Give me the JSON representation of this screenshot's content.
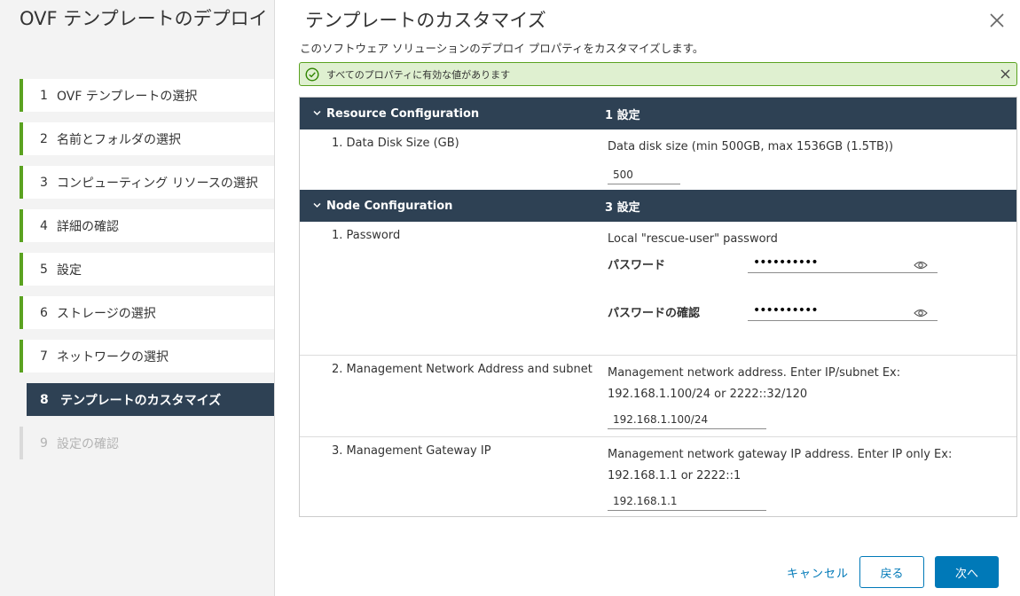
{
  "wizard": {
    "title": "OVF テンプレートのデプロイ",
    "steps": [
      {
        "num": "1",
        "label": "OVF テンプレートの選択"
      },
      {
        "num": "2",
        "label": "名前とフォルダの選択"
      },
      {
        "num": "3",
        "label": "コンピューティング リソースの選択"
      },
      {
        "num": "4",
        "label": "詳細の確認"
      },
      {
        "num": "5",
        "label": "設定"
      },
      {
        "num": "6",
        "label": "ストレージの選択"
      },
      {
        "num": "7",
        "label": "ネットワークの選択"
      },
      {
        "num": "8",
        "label": "テンプレートのカスタマイズ"
      },
      {
        "num": "9",
        "label": "設定の確認"
      }
    ],
    "active_step": 8
  },
  "main": {
    "title": "テンプレートのカスタマイズ",
    "subtitle": "このソフトウェア ソリューションのデプロイ プロパティをカスタマイズします。",
    "alert": "すべてのプロパティに有効な値があります",
    "groups": [
      {
        "name": "Resource Configuration",
        "count": "1 設定",
        "properties": [
          {
            "label": "1. Data Disk Size (GB)",
            "description": "Data disk size (min 500GB, max 1536GB (1.5TB))",
            "value": "500"
          }
        ]
      },
      {
        "name": "Node Configuration",
        "count": "3 設定",
        "properties": [
          {
            "label": "1. Password",
            "description": "Local \"rescue-user\" password",
            "password_label": "パスワード",
            "password_value": "••••••••••",
            "confirm_label": "パスワードの確認",
            "confirm_value": "••••••••••"
          },
          {
            "label": "2. Management Network Address and subnet",
            "description": "Management network address. Enter IP/subnet Ex: 192.168.1.100/24 or 2222::32/120",
            "value": "192.168.1.100/24"
          },
          {
            "label": "3. Management Gateway IP",
            "description": "Management network gateway IP address. Enter IP only Ex: 192.168.1.1 or 2222::1",
            "value": "192.168.1.1"
          }
        ]
      }
    ]
  },
  "footer": {
    "cancel": "キャンセル",
    "back": "戻る",
    "next": "次へ"
  },
  "colors": {
    "accent": "#0079b8",
    "header": "#2e4154",
    "success": "#5aa220",
    "success_bg": "#dff0d0"
  }
}
